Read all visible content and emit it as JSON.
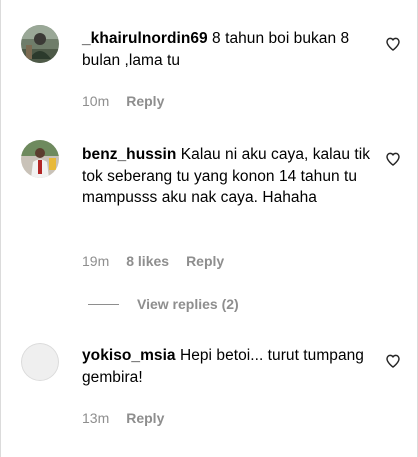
{
  "comments": [
    {
      "username": "_khairulnordin69",
      "text": " 8 tahun boi bukan 8 bulan ,lama tu",
      "time": "10m",
      "reply_label": "Reply",
      "avatar_icon": "user-photo-avatar"
    },
    {
      "username": "benz_hussin",
      "text": " Kalau ni aku caya, kalau tik tok seberang tu yang konon 14 tahun tu mampusss aku nak caya. Hahaha",
      "time": "19m",
      "likes": "8 likes",
      "reply_label": "Reply",
      "avatar_icon": "user-photo-avatar"
    },
    {
      "username": "yokiso_msia",
      "text": " Hepi betoi... turut tumpang gembira!",
      "time": "13m",
      "reply_label": "Reply",
      "avatar_icon": "default-avatar"
    }
  ],
  "view_replies": {
    "label": "View replies (2)"
  },
  "colors": {
    "secondary_text": "#8e8e8e",
    "primary_text": "#000000",
    "border": "#dbdbdb"
  },
  "icons": {
    "like": "heart-outline-icon"
  }
}
